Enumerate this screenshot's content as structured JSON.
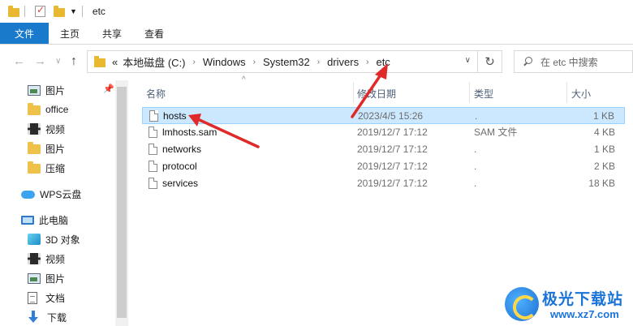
{
  "window": {
    "title": "etc"
  },
  "ribbon": {
    "tabs": [
      "文件",
      "主页",
      "共享",
      "查看"
    ]
  },
  "nav": {
    "breadcrumb_prefix": "«",
    "breadcrumbs": [
      "本地磁盘 (C:)",
      "Windows",
      "System32",
      "drivers",
      "etc"
    ],
    "search_placeholder": "在 etc 中搜索"
  },
  "sidebar": {
    "items": [
      {
        "label": "图片",
        "icon": "picture-icon"
      },
      {
        "label": "office",
        "icon": "folder-icon"
      },
      {
        "label": "视频",
        "icon": "video-icon"
      },
      {
        "label": "图片",
        "icon": "folder-icon"
      },
      {
        "label": "压缩",
        "icon": "folder-icon"
      },
      {
        "label": "WPS云盘",
        "icon": "cloud-icon"
      },
      {
        "label": "此电脑",
        "icon": "computer-icon"
      },
      {
        "label": "3D 对象",
        "icon": "3d-objects-icon"
      },
      {
        "label": "视频",
        "icon": "video-icon"
      },
      {
        "label": "图片",
        "icon": "picture-icon"
      },
      {
        "label": "文档",
        "icon": "document-icon"
      },
      {
        "label": "下载",
        "icon": "download-icon"
      }
    ]
  },
  "filelist": {
    "columns": {
      "name": "名称",
      "date": "修改日期",
      "type": "类型",
      "size": "大小"
    },
    "rows": [
      {
        "name": "hosts",
        "date": "2023/4/5 15:26",
        "type": ".",
        "size": "1 KB",
        "selected": true
      },
      {
        "name": "lmhosts.sam",
        "date": "2019/12/7 17:12",
        "type": "SAM 文件",
        "size": "4 KB",
        "selected": false
      },
      {
        "name": "networks",
        "date": "2019/12/7 17:12",
        "type": ".",
        "size": "1 KB",
        "selected": false
      },
      {
        "name": "protocol",
        "date": "2019/12/7 17:12",
        "type": ".",
        "size": "2 KB",
        "selected": false
      },
      {
        "name": "services",
        "date": "2019/12/7 17:12",
        "type": ".",
        "size": "18 KB",
        "selected": false
      }
    ]
  },
  "watermark": {
    "title": "极光下载站",
    "url": "www.xz7.com"
  },
  "colors": {
    "accent": "#1979ca",
    "selection": "#cce8ff",
    "arrow": "#e02a2a"
  }
}
